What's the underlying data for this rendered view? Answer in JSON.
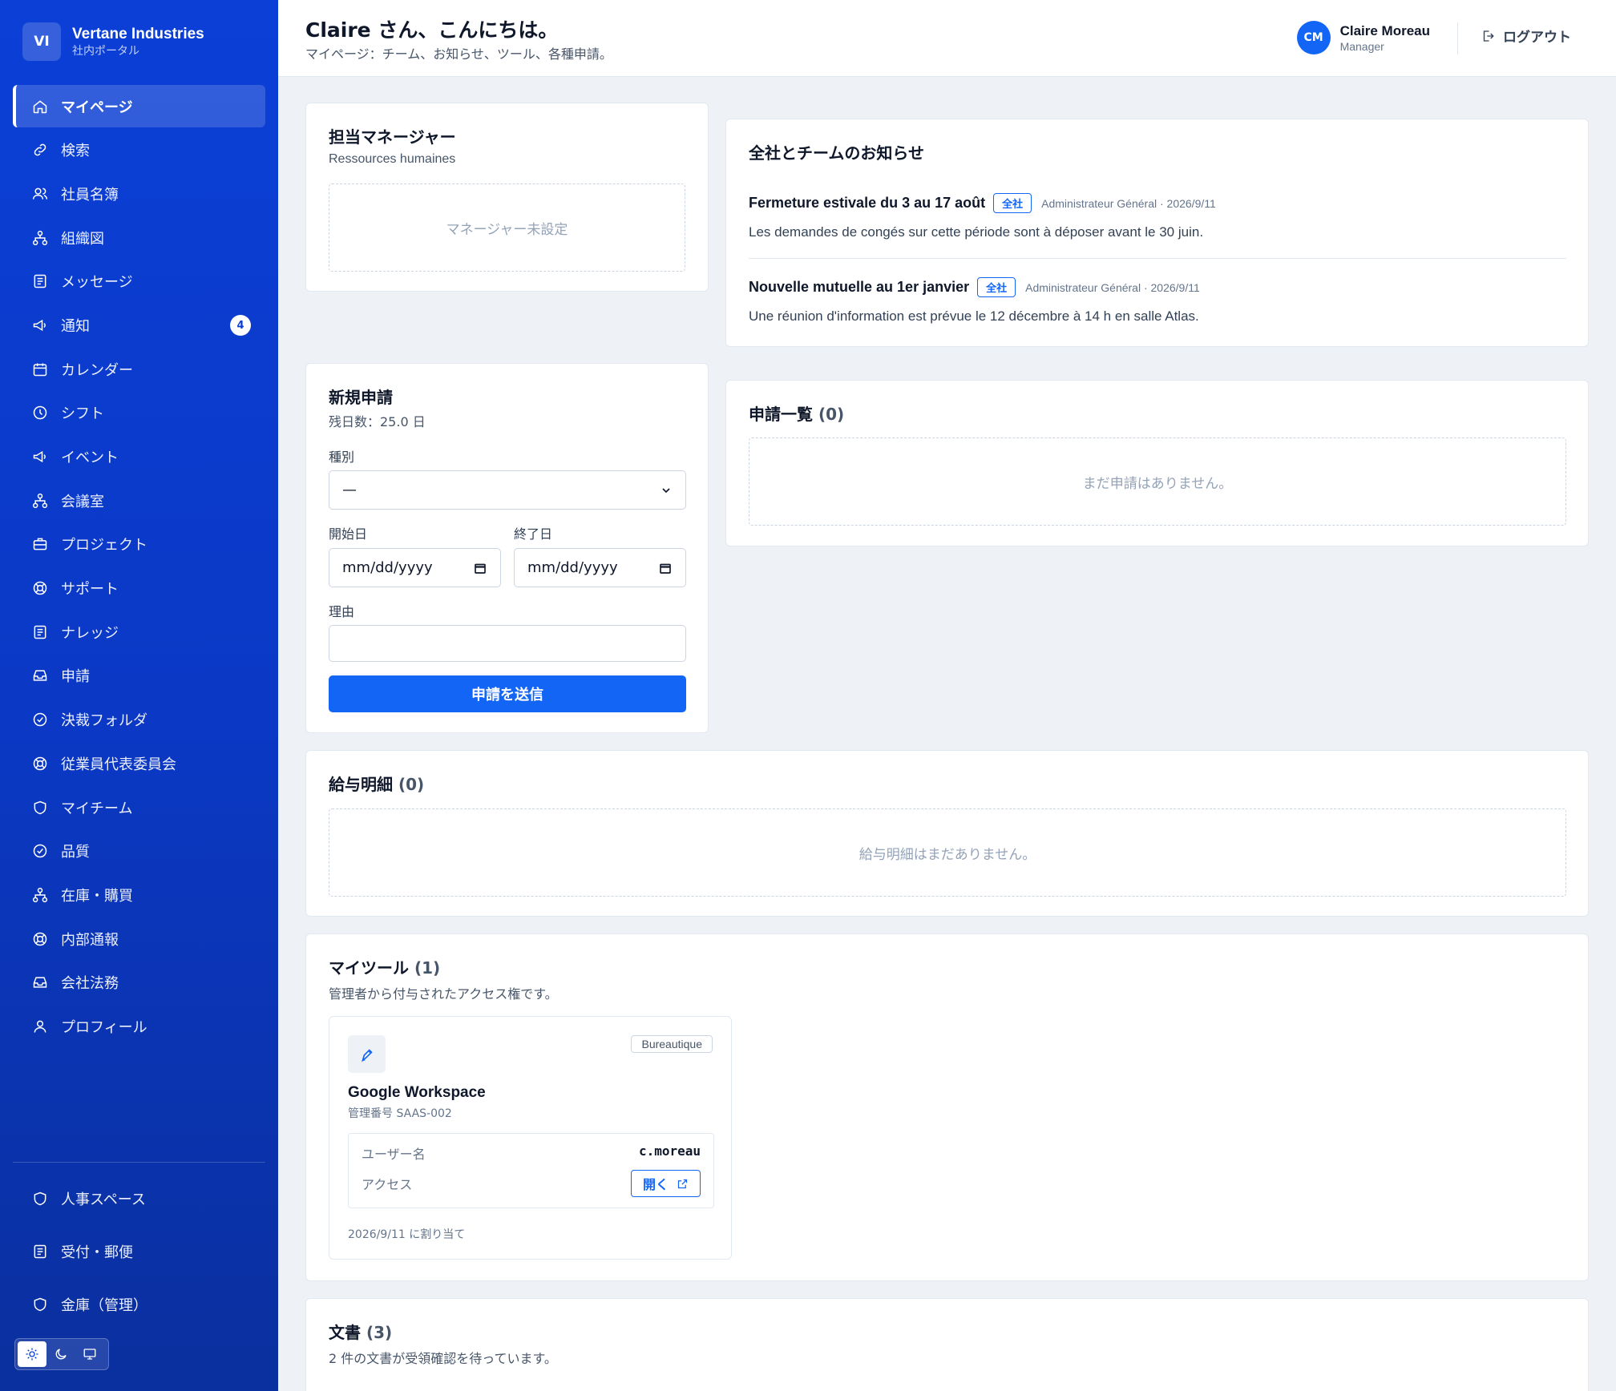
{
  "brand": {
    "logo": "VI",
    "name": "Vertane Industries",
    "subtitle": "社内ポータル"
  },
  "nav": [
    {
      "label": "マイページ",
      "icon": "home-icon",
      "active": true
    },
    {
      "label": "検索",
      "icon": "link-icon"
    },
    {
      "label": "社員名簿",
      "icon": "users-icon"
    },
    {
      "label": "組織図",
      "icon": "org-chart-icon"
    },
    {
      "label": "メッセージ",
      "icon": "document-icon"
    },
    {
      "label": "通知",
      "icon": "megaphone-icon",
      "badge": "4"
    },
    {
      "label": "カレンダー",
      "icon": "calendar-icon"
    },
    {
      "label": "シフト",
      "icon": "clock-icon"
    },
    {
      "label": "イベント",
      "icon": "megaphone-icon"
    },
    {
      "label": "会議室",
      "icon": "org-chart-icon"
    },
    {
      "label": "プロジェクト",
      "icon": "briefcase-icon"
    },
    {
      "label": "サポート",
      "icon": "lifebuoy-icon"
    },
    {
      "label": "ナレッジ",
      "icon": "document-icon"
    },
    {
      "label": "申請",
      "icon": "inbox-icon"
    },
    {
      "label": "決裁フォルダ",
      "icon": "check-circle-icon"
    },
    {
      "label": "従業員代表委員会",
      "icon": "lifebuoy-icon"
    },
    {
      "label": "マイチーム",
      "icon": "shield-icon"
    },
    {
      "label": "品質",
      "icon": "check-circle-icon"
    },
    {
      "label": "在庫・購買",
      "icon": "org-chart-icon"
    },
    {
      "label": "内部通報",
      "icon": "lifebuoy-icon"
    },
    {
      "label": "会社法務",
      "icon": "inbox-icon"
    },
    {
      "label": "プロフィール",
      "icon": "user-icon"
    }
  ],
  "nav_bottom": [
    {
      "label": "人事スペース",
      "icon": "shield-icon"
    },
    {
      "label": "受付・郵便",
      "icon": "document-icon"
    },
    {
      "label": "金庫（管理）",
      "icon": "shield-icon"
    }
  ],
  "header": {
    "greeting": "Claire さん、こんにちは。",
    "subtitle": "マイページ：チーム、お知らせ、ツール、各種申請。",
    "user_initials": "CM",
    "user_name": "Claire Moreau",
    "user_role": "Manager",
    "logout": "ログアウト"
  },
  "manager": {
    "title": "担当マネージャー",
    "subtitle": "Ressources humaines",
    "empty": "マネージャー未設定"
  },
  "announcements": {
    "title": "全社とチームのお知らせ",
    "items": [
      {
        "title": "Fermeture estivale du 3 au 17 août",
        "tag": "全社",
        "meta": "Administrateur Général · 2026/9/11",
        "body": "Les demandes de congés sur cette période sont à déposer avant le 30 juin."
      },
      {
        "title": "Nouvelle mutuelle au 1er janvier",
        "tag": "全社",
        "meta": "Administrateur Général · 2026/9/11",
        "body": "Une réunion d'information est prévue le 12 décembre à 14 h en salle Atlas."
      }
    ]
  },
  "new_request": {
    "title": "新規申請",
    "balance": "残日数：25.0 日",
    "type_label": "種別",
    "type_value": "—",
    "start_label": "開始日",
    "start_placeholder": "mm/dd/yyyy",
    "end_label": "終了日",
    "end_placeholder": "mm/dd/yyyy",
    "reason_label": "理由",
    "reason_value": "",
    "submit": "申請を送信"
  },
  "requests": {
    "title": "申請一覧",
    "count": "(0)",
    "empty": "まだ申請はありません。"
  },
  "payslips": {
    "title": "給与明細",
    "count": "(0)",
    "empty": "給与明細はまだありません。"
  },
  "tools": {
    "title": "マイツール",
    "count": "(1)",
    "subtitle": "管理者から付与されたアクセス権です。",
    "items": [
      {
        "category": "Bureautique",
        "name": "Google Workspace",
        "asset": "管理番号 SAAS-002",
        "username_label": "ユーザー名",
        "username": "c.moreau",
        "access_label": "アクセス",
        "open": "開く",
        "assigned": "2026/9/11 に割り当て"
      }
    ]
  },
  "documents": {
    "title": "文書",
    "count": "(3)",
    "subtitle": "2 件の文書が受領確認を待っています。"
  },
  "colors": {
    "sidebar": "#0b3fd6",
    "accent": "#1366f5",
    "background": "#eef1f5"
  }
}
